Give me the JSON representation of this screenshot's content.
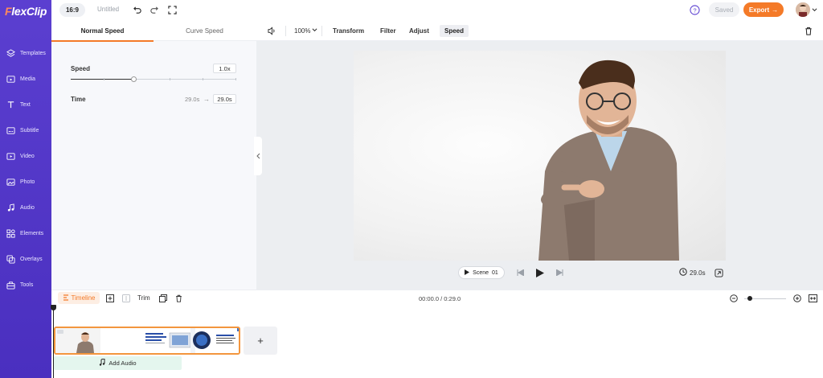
{
  "app": {
    "logo_first": "F",
    "logo_rest": "lexClip"
  },
  "topbar": {
    "ratio": "16:9",
    "title": "Untitled",
    "saved_label": "Saved",
    "export_label": "Export",
    "export_arrow": "→"
  },
  "sidebar": {
    "items": [
      {
        "label": "Templates",
        "icon": "layers-icon"
      },
      {
        "label": "Media",
        "icon": "folder-icon"
      },
      {
        "label": "Text",
        "icon": "text-icon"
      },
      {
        "label": "Subtitle",
        "icon": "subtitle-icon"
      },
      {
        "label": "Video",
        "icon": "video-icon"
      },
      {
        "label": "Photo",
        "icon": "photo-icon"
      },
      {
        "label": "Audio",
        "icon": "music-icon"
      },
      {
        "label": "Elements",
        "icon": "shapes-icon"
      },
      {
        "label": "Overlays",
        "icon": "overlay-icon"
      },
      {
        "label": "Tools",
        "icon": "toolbox-icon"
      }
    ]
  },
  "panel": {
    "tabs": [
      {
        "label": "Normal Speed"
      },
      {
        "label": "Curve Speed"
      }
    ],
    "speed_label": "Speed",
    "speed_value": "1.0x",
    "speed_level": 0.38,
    "time_label": "Time",
    "time_from": "29.0s",
    "time_arrow": "→",
    "time_to": "29.0s"
  },
  "edit_toolbar": {
    "zoom": "100%",
    "transform": "Transform",
    "filter": "Filter",
    "adjust": "Adjust",
    "speed": "Speed"
  },
  "player": {
    "scene_label": "Scene",
    "scene_number": "01",
    "duration": "29.0s"
  },
  "timeline": {
    "label": "Timeline",
    "trim": "Trim",
    "timecode": "00:00.0 / 0:29.0",
    "add_audio": "Add Audio",
    "add_scene": "+"
  },
  "colors": {
    "sidebar": "#4f33c8",
    "accent": "#f47a28",
    "audio_track": "#e4f6ee"
  }
}
